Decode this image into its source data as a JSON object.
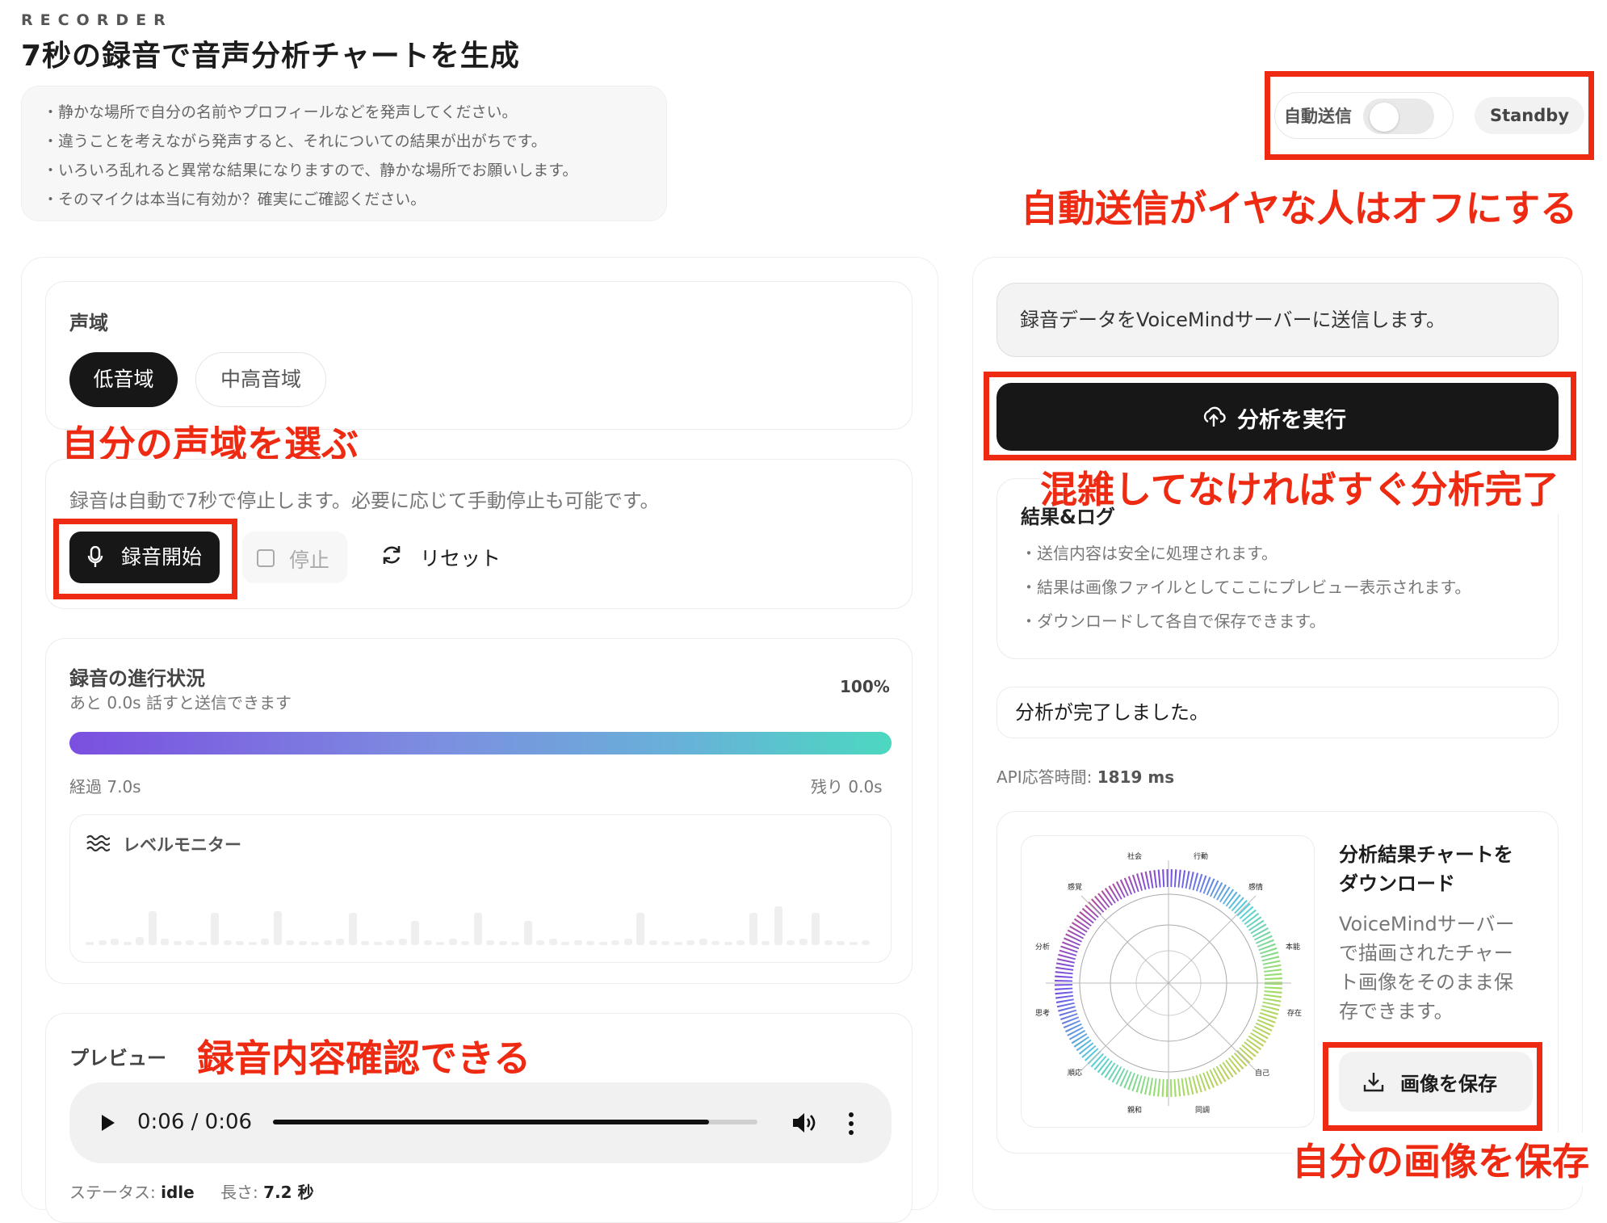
{
  "header": {
    "eyebrow": "RECORDER",
    "title": "7秒の録音で音声分析チャートを生成",
    "notes": [
      "・静かな場所で自分の名前やプロフィールなどを発声してください。",
      "・違うことを考えながら発声すると、それについての結果が出がちです。",
      "・いろいろ乱れると異常な結果になりますので、静かな場所でお願いします。",
      "・そのマイクは本当に有効か？確実にご確認ください。"
    ]
  },
  "topbar": {
    "auto_send_label": "自動送信",
    "auto_send_on": false,
    "status": "Standby"
  },
  "voice_range": {
    "title": "声域",
    "options": [
      "低音域",
      "中高音域"
    ],
    "selected": "低音域"
  },
  "controls": {
    "hint": "録音は自動で7秒で停止します。必要に応じて手動停止も可能です。",
    "record_label": "録音開始",
    "stop_label": "停止",
    "reset_label": "リセット"
  },
  "progress": {
    "title": "録音の進行状況",
    "subtitle": "あと 0.0s 話すと送信できます",
    "percent_label": "100%",
    "percent": 100,
    "elapsed": "経過 7.0s",
    "remaining": "残り 0.0s"
  },
  "level_monitor": {
    "title": "レベルモニター"
  },
  "preview": {
    "title": "プレビュー",
    "time": "0:06 / 0:06",
    "played_fraction": 0.9,
    "status_prefix": "ステータス:",
    "status_value": "idle",
    "length_prefix": "長さ:",
    "length_value": "7.2 秒"
  },
  "send": {
    "message": "録音データをVoiceMindサーバーに送信します。",
    "run_label": "分析を実行"
  },
  "log": {
    "title": "結果&ログ",
    "items": [
      "・送信内容は安全に処理されます。",
      "・結果は画像ファイルとしてここにプレビュー表示されます。",
      "・ダウンロードして各自で保存できます。"
    ],
    "done": "分析が完了しました。",
    "api_prefix": "API応答時間:",
    "api_value": "1819 ms"
  },
  "download": {
    "title_line1": "分析結果チャートを",
    "title_line2": "ダウンロード",
    "desc": [
      "VoiceMindサーバー",
      "で描画されたチャー",
      "ト画像をそのまま保",
      "存できます。"
    ],
    "save_label": "画像を保存",
    "chart_labels": [
      "社会",
      "行動",
      "感情",
      "本能",
      "存在",
      "自己",
      "同調",
      "親和",
      "順応",
      "思考",
      "分析",
      "感覚"
    ]
  },
  "annotations": {
    "auto_send": "自動送信がイヤな人はオフにする",
    "range": "自分の声域を選ぶ",
    "fast": "混雑してなければすぐ分析完了",
    "preview": "録音内容確認できる",
    "save": "自分の画像を保存"
  },
  "colors": {
    "accent_red": "#ee2b12",
    "dark_button": "#171717"
  }
}
